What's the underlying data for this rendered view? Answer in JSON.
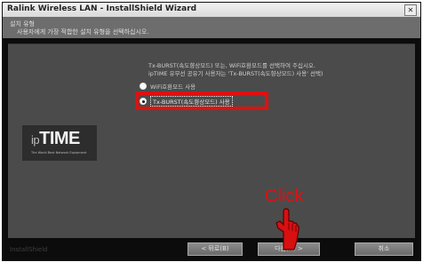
{
  "window": {
    "title": "Ralink Wireless LAN - InstallShield Wizard",
    "close_glyph": "✕"
  },
  "header": {
    "title": "설치 유형",
    "subtitle": "사용자에게 가장 적합한 설치 유형을 선택하십시오."
  },
  "instruction": "Tx-BURST(속도향상모드) 또는, WiFi호환모드를 선택하여 주십시오.\nipTIME 유무선 공유기 사용자는 'Tx-BURST(속도향상모드) 사용' 선택)",
  "options": [
    {
      "label": "WiFi호환모드 사용",
      "selected": false
    },
    {
      "label": "Tx-BURST(속도향상모드) 사용",
      "selected": true
    }
  ],
  "logo": {
    "prefix": "ip",
    "name": "TIME",
    "tagline": "The World Best Network Equipment"
  },
  "footer_brand": "InstallShield",
  "buttons": {
    "back": "< 뒤로(B)",
    "next": "다음(N) >",
    "cancel": "취소"
  },
  "annotation": {
    "text": "Click",
    "color": "#e01010"
  }
}
